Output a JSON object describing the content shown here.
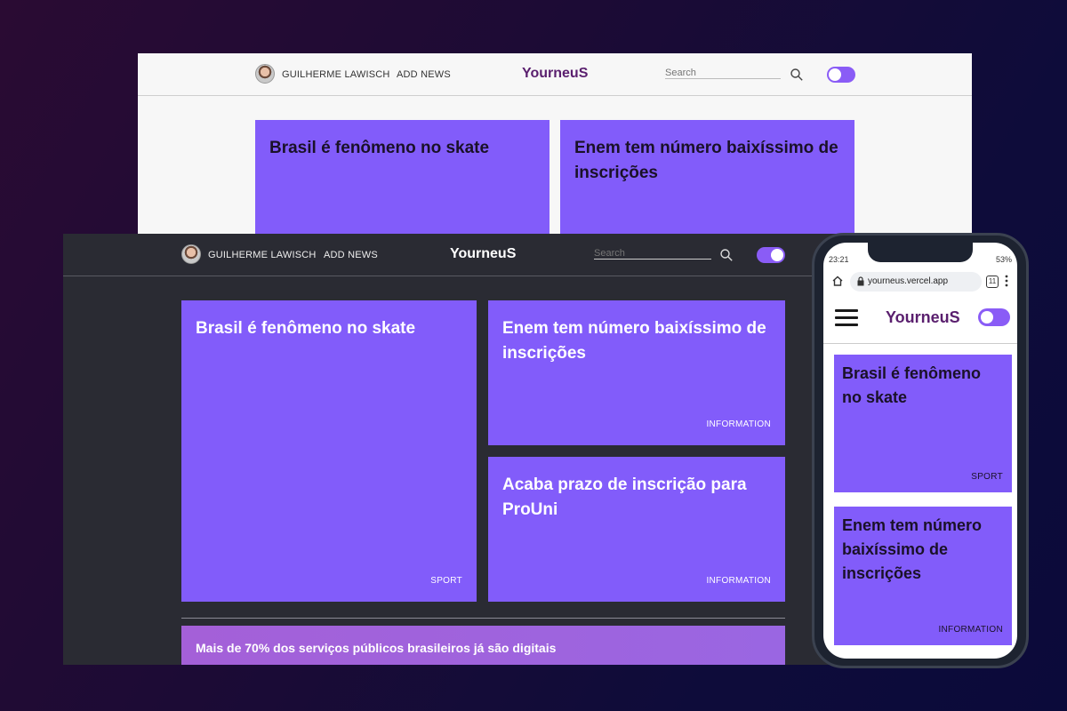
{
  "colors": {
    "accent": "#825cfa",
    "toggle": "#8a5cf6",
    "logo_dark_text": "#ffffff",
    "logo_light_text": "#5a1f6e",
    "dark_bg": "#2a2b33",
    "light_bg": "#f7f7f7",
    "banner": "#a460d8"
  },
  "light_window": {
    "user_name": "GUILHERME LAWISCH",
    "add_news": "ADD NEWS",
    "logo": "YourneuS",
    "search_placeholder": "Search",
    "search_icon": "search-icon",
    "cards": [
      {
        "title": "Brasil é fenômeno no skate"
      },
      {
        "title": "Enem tem número baixíssimo de inscrições"
      }
    ]
  },
  "dark_window": {
    "user_name": "GUILHERME LAWISCH",
    "add_news": "ADD NEWS",
    "logo": "YourneuS",
    "search_placeholder": "Search",
    "search_icon": "search-icon",
    "cards": [
      {
        "title": "Brasil é fenômeno no skate",
        "tag": "SPORT"
      },
      {
        "title": "Enem tem número baixíssimo de inscrições",
        "tag": "INFORMATION"
      },
      {
        "title": "Acaba prazo de inscrição para ProUni",
        "tag": "INFORMATION"
      }
    ],
    "banner": "Mais de 70% dos serviços públicos brasileiros já são digitais"
  },
  "phone": {
    "time": "23:21",
    "battery": "53%",
    "url": "yourneus.vercel.app",
    "tab_count": "11",
    "logo": "YourneuS",
    "cards": [
      {
        "title": "Brasil é fenômeno no skate",
        "tag": "SPORT"
      },
      {
        "title": "Enem tem número baixíssimo de inscrições",
        "tag": "INFORMATION"
      }
    ]
  }
}
